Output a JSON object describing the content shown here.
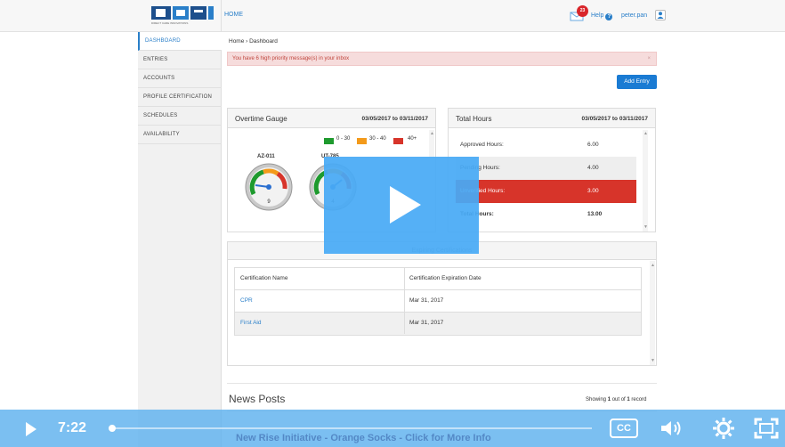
{
  "header": {
    "logo_text": "DCI",
    "logo_tagline": "DIRECT CARE INNOVATIONS",
    "nav_home": "HOME",
    "mail_badge": "23",
    "help_label": "Help",
    "help_icon": "?",
    "username": "peter.pan"
  },
  "sidebar": {
    "items": [
      {
        "label": "DASHBOARD",
        "active": true
      },
      {
        "label": "ENTRIES"
      },
      {
        "label": "ACCOUNTS"
      },
      {
        "label": "PROFILE CERTIFICATION"
      },
      {
        "label": "SCHEDULES"
      },
      {
        "label": "AVAILABILITY"
      }
    ]
  },
  "breadcrumb": "Home › Dashboard",
  "alert": {
    "text": "You have 6 high priority message(s) in your inbox",
    "close": "×"
  },
  "add_entry_label": "Add Entry",
  "overtime": {
    "title": "Overtime Gauge",
    "date_range": "03/05/2017 to 03/11/2017",
    "legend": [
      {
        "label": "0 - 30",
        "color": "#1e9a2e"
      },
      {
        "label": "30 - 40",
        "color": "#f39a1a"
      },
      {
        "label": "40+",
        "color": "#d7342a"
      }
    ],
    "gauges": [
      {
        "label": "AZ-011",
        "value": "9"
      },
      {
        "label": "UT-785",
        "value": "4"
      }
    ]
  },
  "hours": {
    "title": "Total Hours",
    "date_range": "03/05/2017 to 03/11/2017",
    "rows": [
      {
        "label": "Approved Hours:",
        "value": "6.00"
      },
      {
        "label": "Pending Hours:",
        "value": "4.00"
      },
      {
        "label": "Unverified Hours:",
        "value": "3.00"
      },
      {
        "label": "Total Hours:",
        "value": "13.00"
      }
    ]
  },
  "certifications": {
    "title": "Expiring Certifications",
    "columns": [
      "Certification Name",
      "Certification Expiration Date"
    ],
    "rows": [
      {
        "name": "CPR",
        "date": "Mar 31, 2017"
      },
      {
        "name": "First Aid",
        "date": "Mar 31, 2017"
      }
    ]
  },
  "news": {
    "title": "News Posts",
    "count_prefix": "Showing ",
    "count_shown": "1",
    "count_mid": " out of ",
    "count_total": "1",
    "count_suffix": " record",
    "item": "New Rise Initiative - Orange Socks - Click for More Info"
  },
  "video": {
    "time": "7:22",
    "cc_label": "CC",
    "progress_fraction": 0
  }
}
